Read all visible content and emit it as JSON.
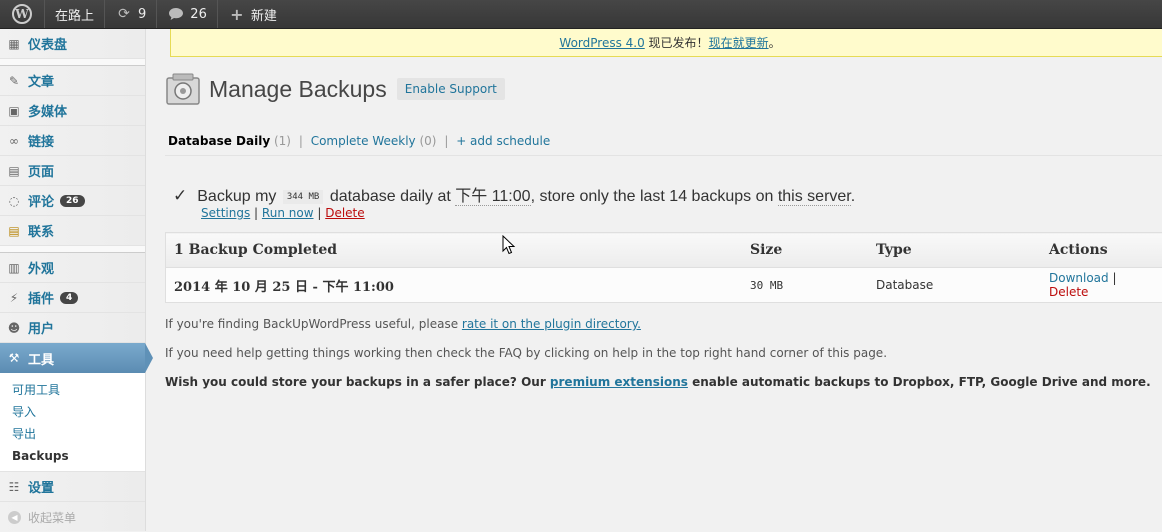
{
  "adminbar": {
    "site_name": "在路上",
    "updates_count": "9",
    "comments_count": "26",
    "new_label": "新建"
  },
  "sidebar": {
    "items": [
      {
        "label": "仪表盘",
        "icon": "dashboard-icon"
      },
      {
        "label": "文章",
        "icon": "pin-icon"
      },
      {
        "label": "多媒体",
        "icon": "media-icon"
      },
      {
        "label": "链接",
        "icon": "link-icon"
      },
      {
        "label": "页面",
        "icon": "page-icon"
      },
      {
        "label": "评论",
        "icon": "comment-icon",
        "count": "26"
      },
      {
        "label": "联系",
        "icon": "contact-icon"
      },
      {
        "label": "外观",
        "icon": "appearance-icon"
      },
      {
        "label": "插件",
        "icon": "plugin-icon",
        "count": "4"
      },
      {
        "label": "用户",
        "icon": "users-icon"
      },
      {
        "label": "工具",
        "icon": "tools-icon"
      },
      {
        "label": "设置",
        "icon": "settings-icon"
      }
    ],
    "submenu": [
      "可用工具",
      "导入",
      "导出",
      "Backups"
    ],
    "collapse_label": "收起菜单"
  },
  "notice": {
    "link1": "WordPress 4.0",
    "text": " 现已发布！",
    "link2": "现在就更新",
    "end": "。"
  },
  "page": {
    "title": "Manage Backups",
    "support_button": "Enable Support"
  },
  "tabs": {
    "tab1": "Database Daily",
    "tab1_count": "(1)",
    "tab2": "Complete Weekly",
    "tab2_count": "(0)",
    "add": "+ add schedule",
    "sep": "|"
  },
  "schedule": {
    "check": "✓",
    "text1": "Backup my",
    "size": "344 MB",
    "text2": "database daily at",
    "time": "下午 11:00",
    "text3": ", store only the last 14 backups on",
    "text4": "this server",
    "text5": ".",
    "settings": "Settings",
    "run_now": "Run now",
    "delete": "Delete",
    "sep": "|"
  },
  "table": {
    "headers": {
      "completed": "1 Backup Completed",
      "size": "Size",
      "type": "Type",
      "actions": "Actions"
    },
    "row": {
      "date": "2014 年 10 月 25 日 - 下午 11:00",
      "size": "30 MB",
      "type": "Database",
      "download": "Download",
      "sep": "|",
      "delete": "Delete"
    }
  },
  "footer": {
    "p1_text": "If you're finding BackUpWordPress useful, please ",
    "p1_link": "rate it on the plugin directory.",
    "p2_text": "If you need help getting things working then check the FAQ by clicking on help in the top right hand corner of this page.",
    "p3_text1": "Wish you could store your backups in a safer place? Our ",
    "p3_link": "premium extensions",
    "p3_text2": " enable automatic backups to Dropbox, FTP, Google Drive and more."
  },
  "colors": {
    "link": "#21759b",
    "delete": "#bc0b0b",
    "active_menu": "#6b9cc0",
    "notice_bg": "#fffbcc"
  }
}
